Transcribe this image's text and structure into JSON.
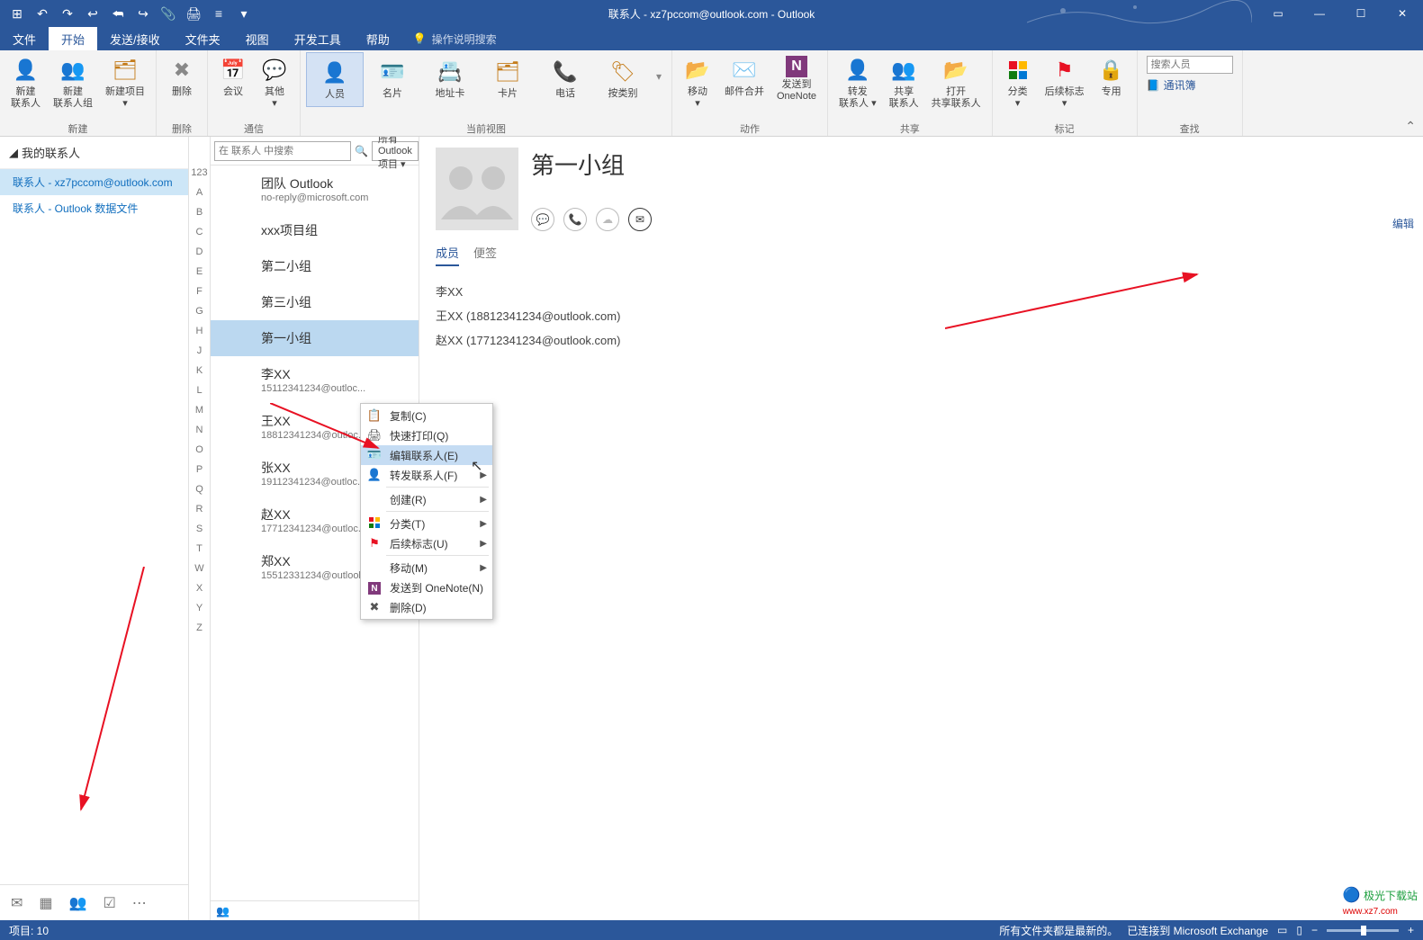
{
  "title": "联系人 - xz7pccom@outlook.com - Outlook",
  "qat_icons": [
    "window",
    "undo",
    "redo",
    "reply",
    "reply-all",
    "forward",
    "attach",
    "print",
    "rules",
    "qat-more"
  ],
  "tabs": [
    "文件",
    "开始",
    "发送/接收",
    "文件夹",
    "视图",
    "开发工具",
    "帮助"
  ],
  "tellme": "操作说明搜索",
  "ribbon": {
    "new": {
      "label": "新建",
      "btns": [
        {
          "icon": "👤",
          "lbl": "新建\n联系人"
        },
        {
          "icon": "👥",
          "lbl": "新建\n联系人组"
        },
        {
          "icon": "🗂",
          "lbl": "新建项目\n▾"
        }
      ]
    },
    "del": {
      "label": "删除",
      "btns": [
        {
          "icon": "✖",
          "lbl": "删除"
        }
      ]
    },
    "comm": {
      "label": "通信",
      "btns": [
        {
          "icon": "📅",
          "lbl": "会议"
        },
        {
          "icon": "⋯",
          "lbl": "其他\n▾"
        }
      ]
    },
    "view": {
      "label": "当前视图",
      "btns": [
        {
          "icon": "👤",
          "lbl": "人员",
          "sel": true
        },
        {
          "icon": "🪪",
          "lbl": "名片"
        },
        {
          "icon": "📇",
          "lbl": "地址卡"
        },
        {
          "icon": "🗂",
          "lbl": "卡片"
        },
        {
          "icon": "📞",
          "lbl": "电话"
        },
        {
          "icon": "🏷",
          "lbl": "按类别"
        }
      ]
    },
    "act": {
      "label": "动作",
      "btns": [
        {
          "icon": "📂",
          "lbl": "移动\n▾"
        },
        {
          "icon": "✉️",
          "lbl": "邮件合并"
        },
        {
          "icon": "N",
          "lbl": "发送到\nOneNote"
        }
      ]
    },
    "share": {
      "label": "共享",
      "btns": [
        {
          "icon": "👤",
          "lbl": "转发\n联系人 ▾"
        },
        {
          "icon": "👥",
          "lbl": "共享\n联系人"
        },
        {
          "icon": "📂",
          "lbl": "打开\n共享联系人"
        }
      ]
    },
    "tag": {
      "label": "标记",
      "btns": [
        {
          "icon": "▦",
          "lbl": "分类\n▾"
        },
        {
          "icon": "⚑",
          "lbl": "后续标志\n▾"
        },
        {
          "icon": "🔒",
          "lbl": "专用"
        }
      ]
    },
    "find": {
      "label": "查找",
      "ph": "搜索人员",
      "ab": "通讯簿"
    }
  },
  "nav": {
    "head": "我的联系人",
    "items": [
      {
        "lbl": "联系人 - xz7pccom@outlook.com",
        "sel": true
      },
      {
        "lbl": "联系人 - Outlook 数据文件"
      }
    ]
  },
  "alpha": [
    "123",
    "A",
    "B",
    "C",
    "D",
    "E",
    "F",
    "G",
    "H",
    "J",
    "K",
    "L",
    "M",
    "N",
    "O",
    "P",
    "Q",
    "R",
    "S",
    "T",
    "W",
    "X",
    "Y",
    "Z"
  ],
  "search": {
    "ph": "在 联系人 中搜索",
    "filter": "所有 Outlook 项目 ▾"
  },
  "list": [
    {
      "nm": "团队 Outlook",
      "sub": "no-reply@microsoft.com"
    },
    {
      "nm": "xxx项目组",
      "sub": ""
    },
    {
      "nm": "第二小组",
      "sub": ""
    },
    {
      "nm": "第三小组",
      "sub": ""
    },
    {
      "nm": "第一小组",
      "sub": "",
      "sel": true
    },
    {
      "nm": "李XX",
      "sub": "15112341234@outloc..."
    },
    {
      "nm": "王XX",
      "sub": "18812341234@outloc..."
    },
    {
      "nm": "张XX",
      "sub": "19112341234@outloc..."
    },
    {
      "nm": "赵XX",
      "sub": "17712341234@outloc..."
    },
    {
      "nm": "郑XX",
      "sub": "15512331234@outlook.com"
    }
  ],
  "read": {
    "name": "第一小组",
    "tabs": [
      "成员",
      "便签"
    ],
    "members": [
      "李XX",
      "王XX (18812341234@outlook.com)",
      "赵XX (17712341234@outlook.com)"
    ],
    "edit": "编辑"
  },
  "ctx": [
    {
      "ico": "📋",
      "lbl": "复制(C)"
    },
    {
      "ico": "🖨",
      "lbl": "快速打印(Q)"
    },
    {
      "ico": "🪪",
      "lbl": "编辑联系人(E)",
      "hl": true
    },
    {
      "ico": "👤",
      "lbl": "转发联系人(F)",
      "sub": true
    },
    {
      "sep": true
    },
    {
      "ico": "",
      "lbl": "创建(R)",
      "sub": true
    },
    {
      "sep": true
    },
    {
      "ico": "▦",
      "lbl": "分类(T)",
      "sub": true
    },
    {
      "ico": "⚑",
      "lbl": "后续标志(U)",
      "sub": true
    },
    {
      "sep": true
    },
    {
      "ico": "",
      "lbl": "移动(M)",
      "sub": true
    },
    {
      "ico": "N",
      "lbl": "发送到 OneNote(N)"
    },
    {
      "ico": "✖",
      "lbl": "删除(D)"
    }
  ],
  "status": {
    "left": "项目: 10",
    "r1": "所有文件夹都是最新的。",
    "r2": "已连接到 Microsoft Exchange"
  },
  "wm": {
    "t": "极光下载站",
    "u": "www.xz7.com"
  }
}
